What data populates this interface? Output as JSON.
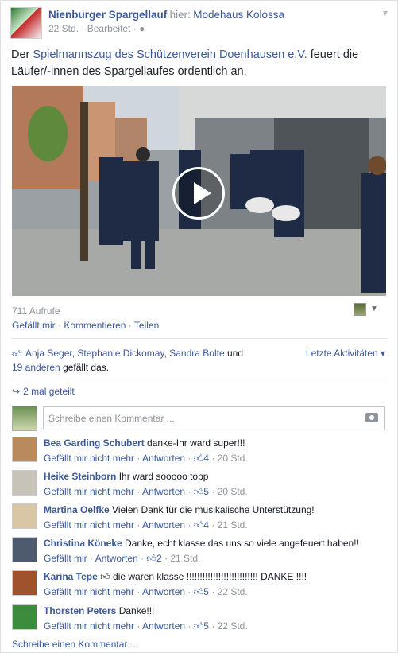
{
  "post": {
    "page_name": "Nienburger Spargellauf",
    "hier_label": "hier:",
    "place": "Modehaus Kolossa",
    "time": "22 Std.",
    "edited": "Bearbeitet",
    "text_prefix": "Der",
    "text_link": "Spielmannszug des Schützenverein Doenhausen e.V.",
    "text_suffix": "feuert die Läufer/-innen des Spargellaufes ordentlich an."
  },
  "video": {
    "views": "711 Aufrufe"
  },
  "actions": {
    "like": "Gefällt mir",
    "comment": "Kommentieren",
    "share": "Teilen",
    "sep": "·"
  },
  "likes": {
    "names": [
      "Anja Seger",
      "Stephanie Dickomay",
      "Sandra Bolte"
    ],
    "and": "und",
    "others": "19 anderen",
    "suffix": "gefällt das.",
    "latest": "Letzte Aktivitäten"
  },
  "shares": {
    "label": "2 mal geteilt"
  },
  "comment_input": {
    "placeholder": "Schreibe einen Kommentar ..."
  },
  "comments": [
    {
      "name": "Bea Garding Schubert",
      "text": "danke-Ihr ward super!!!",
      "like_action": "Gefällt mir nicht mehr",
      "reply": "Antworten",
      "likes": "4",
      "time": "20 Std.",
      "avatar_color": "#b98a5e"
    },
    {
      "name": "Heike Steinborn",
      "text": "Ihr ward sooooo topp",
      "like_action": "Gefällt mir nicht mehr",
      "reply": "Antworten",
      "likes": "5",
      "time": "20 Std.",
      "avatar_color": "#c8c3b8"
    },
    {
      "name": "Martina Oelfke",
      "text": "Vielen Dank für die musikalische Unterstützung!",
      "like_action": "Gefällt mir nicht mehr",
      "reply": "Antworten",
      "likes": "4",
      "time": "21 Std.",
      "avatar_color": "#d9c6a4"
    },
    {
      "name": "Christina Köneke",
      "text": "Danke, echt klasse das uns so viele angefeuert haben!!",
      "like_action": "Gefällt mir",
      "reply": "Antworten",
      "likes": "2",
      "time": "21 Std.",
      "avatar_color": "#4e5a6e"
    },
    {
      "name": "Karina Tepe",
      "text": "die waren klasse !!!!!!!!!!!!!!!!!!!!!!!!!!! DANKE !!!!",
      "like_action": "Gefällt mir nicht mehr",
      "reply": "Antworten",
      "likes": "5",
      "time": "22 Std.",
      "avatar_color": "#a0522d"
    },
    {
      "name": "Thorsten Peters",
      "text": "Danke!!!",
      "like_action": "Gefällt mir nicht mehr",
      "reply": "Antworten",
      "likes": "5",
      "time": "22 Std.",
      "avatar_color": "#3d8c3d"
    }
  ],
  "footer": {
    "more": "Schreibe einen Kommentar ..."
  },
  "colors": {
    "link": "#3b5998",
    "meta": "#90949c"
  }
}
